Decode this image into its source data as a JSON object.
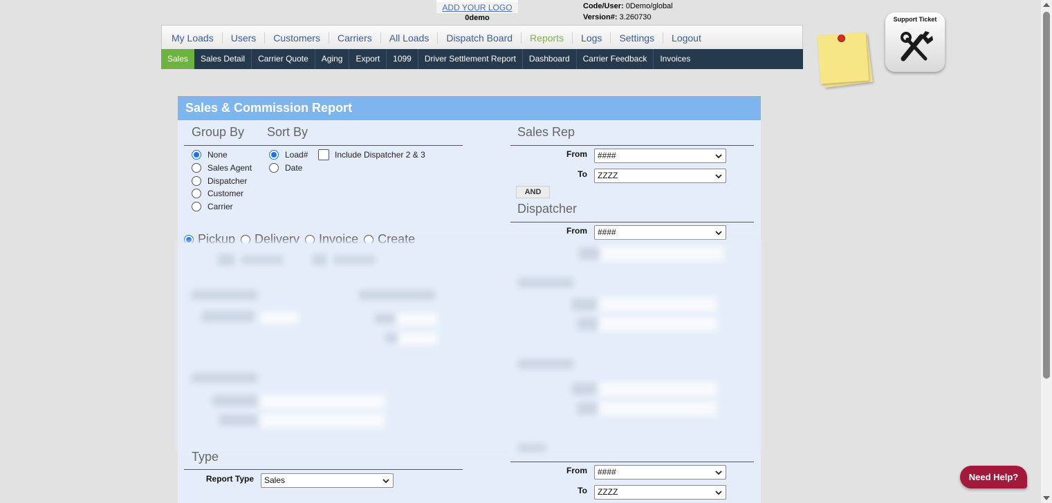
{
  "header": {
    "logo_link": "ADD YOUR LOGO",
    "company": "0demo",
    "code_user_label": "Code/User:",
    "code_user_value": " 0Demo/global",
    "version_label": "Version#:",
    "version_value": " 3.260730",
    "support_ticket_label": "Support Ticket"
  },
  "nav": {
    "items": [
      "My Loads",
      "Users",
      "Customers",
      "Carriers",
      "All Loads",
      "Dispatch Board",
      "Reports",
      "Logs",
      "Settings",
      "Logout"
    ],
    "active": "Reports"
  },
  "subnav": {
    "items": [
      "Sales",
      "Sales Detail",
      "Carrier Quote",
      "Aging",
      "Export",
      "1099",
      "Driver Settlement Report",
      "Dashboard",
      "Carrier Feedback",
      "Invoices"
    ],
    "active": "Sales"
  },
  "report": {
    "title": "Sales & Commission Report",
    "group_by": {
      "title": "Group By",
      "options": [
        "None",
        "Sales Agent",
        "Dispatcher",
        "Customer",
        "Carrier"
      ],
      "selected": "None"
    },
    "sort_by": {
      "title": "Sort By",
      "options": [
        "Load#",
        "Date"
      ],
      "selected": "Load#"
    },
    "include_dispatcher_label": "Include Dispatcher 2 & 3",
    "date_type": {
      "options": [
        "Pickup",
        "Delivery",
        "Invoice",
        "Create"
      ],
      "selected": "Pickup"
    },
    "sales_rep": {
      "title": "Sales Rep",
      "from_label": "From",
      "from_value": "####",
      "to_label": "To",
      "to_value": "ZZZZ"
    },
    "and_button": "AND",
    "dispatcher": {
      "title": "Dispatcher",
      "from_label": "From",
      "from_value": "####"
    },
    "type": {
      "title": "Type",
      "report_type_label": "Report Type",
      "report_type_value": "Sales"
    },
    "bottom_range": {
      "from_label": "From",
      "from_value": "####",
      "to_label": "To",
      "to_value": "ZZZZ"
    }
  },
  "need_help": "Need Help?",
  "colors": {
    "nav_active": "#7cb342",
    "subnav_bg": "#263a4d",
    "subnav_active": "#6cb33f",
    "panel_header": "#7db5ec",
    "panel_bg": "#e4edf9",
    "need_help_bg": "#a3193c"
  }
}
